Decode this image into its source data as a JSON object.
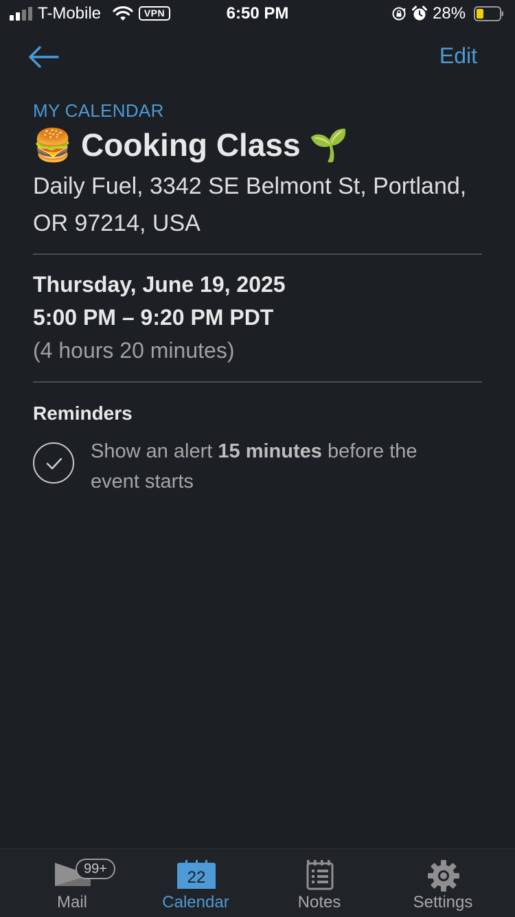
{
  "status_bar": {
    "carrier": "T-Mobile",
    "vpn": "VPN",
    "time": "6:50 PM",
    "battery": "28%"
  },
  "nav": {
    "back_icon": "arrow-left-icon",
    "edit_label": "Edit"
  },
  "event": {
    "calendar_name": "MY CALENDAR",
    "title": "🍔 Cooking Class 🌱",
    "location": "Daily Fuel, 3342 SE Belmont St, Portland, OR 97214, USA",
    "date": "Thursday, June 19, 2025",
    "time_range": "5:00 PM – 9:20 PM PDT",
    "duration": "(4 hours 20 minutes)"
  },
  "reminders": {
    "heading": "Reminders",
    "items": [
      {
        "prefix": "Show an alert ",
        "emphasis": "15 minutes",
        "suffix": " before the event starts",
        "icon": "check-circle-icon"
      }
    ]
  },
  "tab_bar": {
    "tabs": [
      {
        "label": "Mail",
        "icon": "mail-icon",
        "badge": "99+"
      },
      {
        "label": "Calendar",
        "icon": "calendar-icon",
        "day": "22",
        "active": true
      },
      {
        "label": "Notes",
        "icon": "notes-icon"
      },
      {
        "label": "Settings",
        "icon": "gear-icon"
      }
    ]
  },
  "colors": {
    "background": "#1c1f23",
    "accent": "#4d9ad6",
    "battery_level": "#f5d000"
  }
}
